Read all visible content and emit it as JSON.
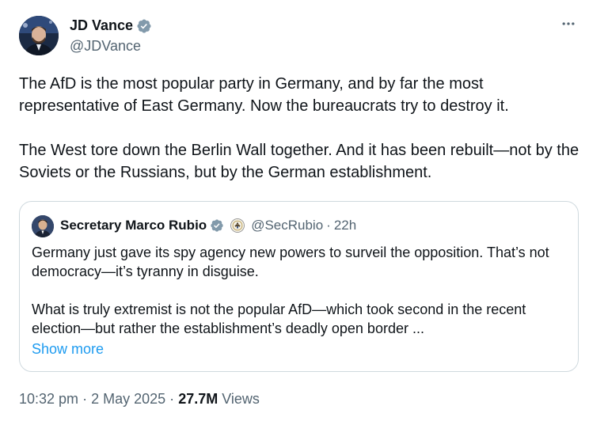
{
  "author": {
    "name": "JD Vance",
    "handle": "@JDVance",
    "verified_icon": "verified-badge-icon"
  },
  "more_icon": "more-horizontal-icon",
  "tweet": {
    "paragraphs": [
      "The AfD is the most popular party in Germany, and by far the most representative of East Germany. Now the bureaucrats try to destroy it.",
      "The West tore down the Berlin Wall together. And it has been rebuilt—not by the Soviets or the Russians, but by the German establishment."
    ]
  },
  "quote": {
    "name": "Secretary Marco Rubio",
    "handle": "@SecRubio",
    "separator": "·",
    "time": "22h",
    "affiliation_icon": "state-department-seal-icon",
    "paragraphs": [
      "Germany just gave its spy agency new powers to surveil the opposition.  That’s not democracy—it’s tyranny in disguise.",
      "What is truly extremist is not the popular AfD—which took second in the recent election—but rather the establishment’s deadly open border ..."
    ],
    "show_more": "Show more"
  },
  "meta": {
    "time": "10:32 pm",
    "separator": "·",
    "date": "2 May 2025",
    "views_count": "27.7M",
    "views_label": "Views"
  },
  "colors": {
    "text": "#0f1419",
    "secondary": "#536471",
    "link": "#1d9bf0",
    "verified": "#829aab",
    "border": "#cfd9de"
  }
}
